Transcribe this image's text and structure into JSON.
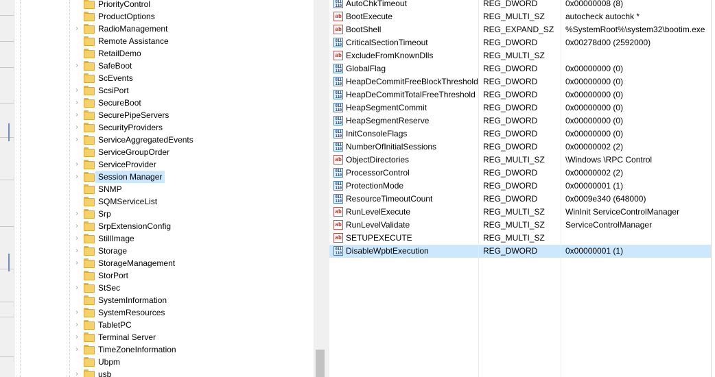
{
  "tree": {
    "items": [
      {
        "label": "PriorityControl",
        "expandable": false
      },
      {
        "label": "ProductOptions",
        "expandable": false
      },
      {
        "label": "RadioManagement",
        "expandable": true
      },
      {
        "label": "Remote Assistance",
        "expandable": false
      },
      {
        "label": "RetailDemo",
        "expandable": false
      },
      {
        "label": "SafeBoot",
        "expandable": true
      },
      {
        "label": "ScEvents",
        "expandable": false
      },
      {
        "label": "ScsiPort",
        "expandable": true
      },
      {
        "label": "SecureBoot",
        "expandable": true
      },
      {
        "label": "SecurePipeServers",
        "expandable": true
      },
      {
        "label": "SecurityProviders",
        "expandable": true
      },
      {
        "label": "ServiceAggregatedEvents",
        "expandable": true
      },
      {
        "label": "ServiceGroupOrder",
        "expandable": false
      },
      {
        "label": "ServiceProvider",
        "expandable": true
      },
      {
        "label": "Session Manager",
        "expandable": true,
        "selected": true
      },
      {
        "label": "SNMP",
        "expandable": false
      },
      {
        "label": "SQMServiceList",
        "expandable": false
      },
      {
        "label": "Srp",
        "expandable": true
      },
      {
        "label": "SrpExtensionConfig",
        "expandable": true
      },
      {
        "label": "StillImage",
        "expandable": true
      },
      {
        "label": "Storage",
        "expandable": true
      },
      {
        "label": "StorageManagement",
        "expandable": true
      },
      {
        "label": "StorPort",
        "expandable": false
      },
      {
        "label": "StSec",
        "expandable": true
      },
      {
        "label": "SystemInformation",
        "expandable": false
      },
      {
        "label": "SystemResources",
        "expandable": true
      },
      {
        "label": "TabletPC",
        "expandable": true
      },
      {
        "label": "Terminal Server",
        "expandable": true
      },
      {
        "label": "TimeZoneInformation",
        "expandable": true
      },
      {
        "label": "Ubpm",
        "expandable": false
      },
      {
        "label": "usb",
        "expandable": true
      }
    ]
  },
  "values": {
    "rows": [
      {
        "icon": "dword-value-icon",
        "name": "AutoChkTimeout",
        "type": "REG_DWORD",
        "data": "0x00000008 (8)"
      },
      {
        "icon": "string-value-icon",
        "name": "BootExecute",
        "type": "REG_MULTI_SZ",
        "data": "autocheck autochk *"
      },
      {
        "icon": "string-value-icon",
        "name": "BootShell",
        "type": "REG_EXPAND_SZ",
        "data": "%SystemRoot%\\system32\\bootim.exe"
      },
      {
        "icon": "dword-value-icon",
        "name": "CriticalSectionTimeout",
        "type": "REG_DWORD",
        "data": "0x00278d00 (2592000)"
      },
      {
        "icon": "string-value-icon",
        "name": "ExcludeFromKnownDlls",
        "type": "REG_MULTI_SZ",
        "data": ""
      },
      {
        "icon": "dword-value-icon",
        "name": "GlobalFlag",
        "type": "REG_DWORD",
        "data": "0x00000000 (0)"
      },
      {
        "icon": "dword-value-icon",
        "name": "HeapDeCommitFreeBlockThreshold",
        "type": "REG_DWORD",
        "data": "0x00000000 (0)"
      },
      {
        "icon": "dword-value-icon",
        "name": "HeapDeCommitTotalFreeThreshold",
        "type": "REG_DWORD",
        "data": "0x00000000 (0)"
      },
      {
        "icon": "dword-value-icon",
        "name": "HeapSegmentCommit",
        "type": "REG_DWORD",
        "data": "0x00000000 (0)"
      },
      {
        "icon": "dword-value-icon",
        "name": "HeapSegmentReserve",
        "type": "REG_DWORD",
        "data": "0x00000000 (0)"
      },
      {
        "icon": "dword-value-icon",
        "name": "InitConsoleFlags",
        "type": "REG_DWORD",
        "data": "0x00000000 (0)"
      },
      {
        "icon": "dword-value-icon",
        "name": "NumberOfInitialSessions",
        "type": "REG_DWORD",
        "data": "0x00000002 (2)"
      },
      {
        "icon": "string-value-icon",
        "name": "ObjectDirectories",
        "type": "REG_MULTI_SZ",
        "data": "\\Windows \\RPC Control"
      },
      {
        "icon": "dword-value-icon",
        "name": "ProcessorControl",
        "type": "REG_DWORD",
        "data": "0x00000002 (2)"
      },
      {
        "icon": "dword-value-icon",
        "name": "ProtectionMode",
        "type": "REG_DWORD",
        "data": "0x00000001 (1)"
      },
      {
        "icon": "dword-value-icon",
        "name": "ResourceTimeoutCount",
        "type": "REG_DWORD",
        "data": "0x0009e340 (648000)"
      },
      {
        "icon": "string-value-icon",
        "name": "RunLevelExecute",
        "type": "REG_MULTI_SZ",
        "data": "WinInit ServiceControlManager"
      },
      {
        "icon": "string-value-icon",
        "name": "RunLevelValidate",
        "type": "REG_MULTI_SZ",
        "data": "ServiceControlManager"
      },
      {
        "icon": "string-value-icon",
        "name": "SETUPEXECUTE",
        "type": "REG_MULTI_SZ",
        "data": ""
      },
      {
        "icon": "dword-value-icon",
        "name": "DisableWpbtExecution",
        "type": "REG_DWORD",
        "data": "0x00000001 (1)",
        "selected": true
      }
    ]
  },
  "icons": {
    "tree_expand": "chevron-right-icon",
    "tree_folder": "folder-icon",
    "string_glyph": "ab",
    "dword_glyph": "011\n110"
  },
  "colors": {
    "selection": "#cce8ff",
    "folder": "#f6d167",
    "string_icon": "#c0392b",
    "dword_icon": "#1f4e9a"
  }
}
